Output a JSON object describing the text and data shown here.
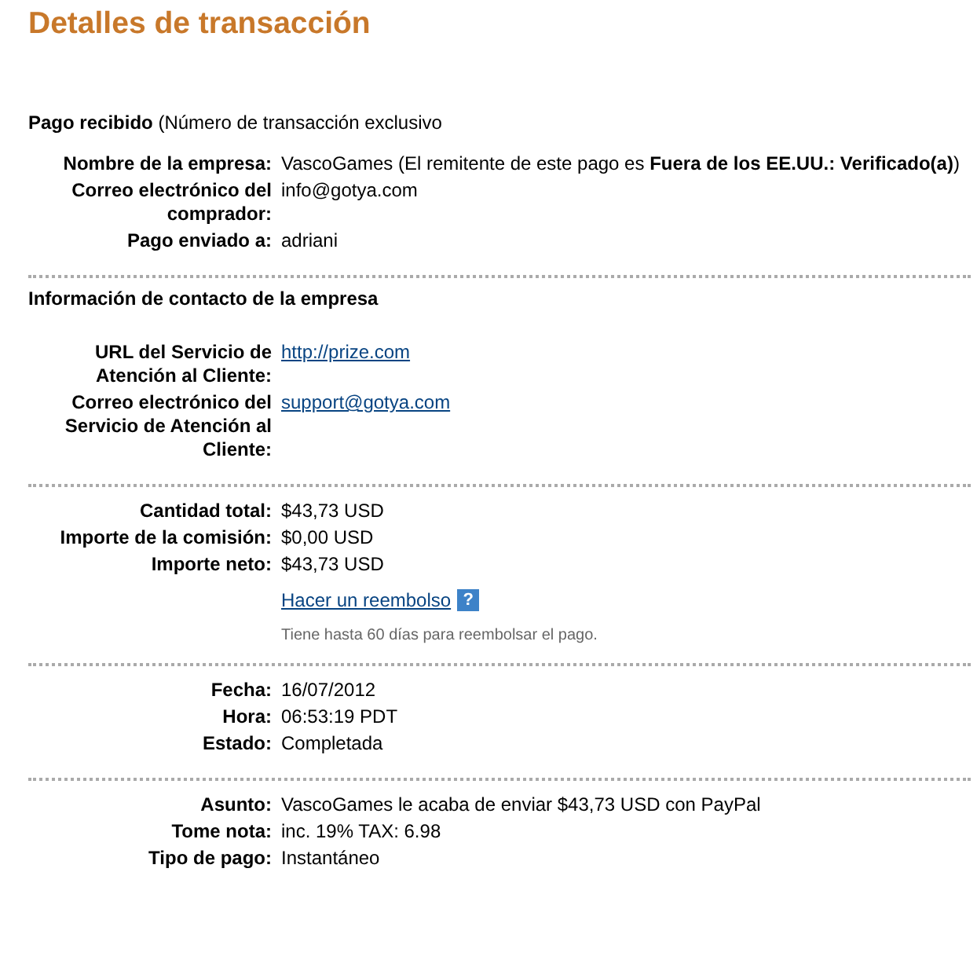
{
  "title": "Detalles de transacción",
  "sections": [
    {
      "heading": "**Pago recibido** (Número de transacción exclusivo",
      "rows": [
        {
          "label": "Nombre de la empresa:",
          "value": "VascoGames (El remitente de este pago es **Fuera de los EE.UU.: Verificado(a)**)",
          "kind": "text"
        },
        {
          "label": "Correo electrónico del comprador:",
          "value": "info@gotya.com",
          "kind": "text"
        },
        {
          "label": "Pago enviado a:",
          "value": "adriani",
          "kind": "text"
        }
      ]
    },
    {
      "heading": "Información de contacto de la empresa",
      "rows": [
        {
          "label": "URL del Servicio de Atención al Cliente:",
          "value": "http://prize.com",
          "kind": "link"
        },
        {
          "label": "Correo electrónico del Servicio de Atención al Cliente:",
          "value": "support@gotya.com",
          "kind": "link"
        }
      ]
    },
    {
      "rows": [
        {
          "label": "Cantidad total:",
          "value": "$43,73 USD",
          "kind": "text"
        },
        {
          "label": "Importe de la comisión:",
          "value": "$0,00 USD",
          "kind": "text"
        },
        {
          "label": "Importe neto:",
          "value": "$43,73 USD",
          "kind": "text"
        }
      ],
      "refund": {
        "link": "Hacer un reembolso",
        "help": "?",
        "note": "Tiene hasta 60 días para reembolsar el pago."
      }
    },
    {
      "rows": [
        {
          "label": "Fecha:",
          "value": "16/07/2012",
          "kind": "text"
        },
        {
          "label": "Hora:",
          "value": "06:53:19 PDT",
          "kind": "text"
        },
        {
          "label": "Estado:",
          "value": "Completada",
          "kind": "text"
        }
      ]
    },
    {
      "rows": [
        {
          "label": "Asunto:",
          "value": "VascoGames le acaba de enviar $43,73 USD con PayPal",
          "kind": "text"
        },
        {
          "label": "Tome nota:",
          "value": "inc. 19% TAX: 6.98",
          "kind": "text"
        },
        {
          "label": "Tipo de pago:",
          "value": "Instantáneo",
          "kind": "text"
        }
      ]
    }
  ]
}
